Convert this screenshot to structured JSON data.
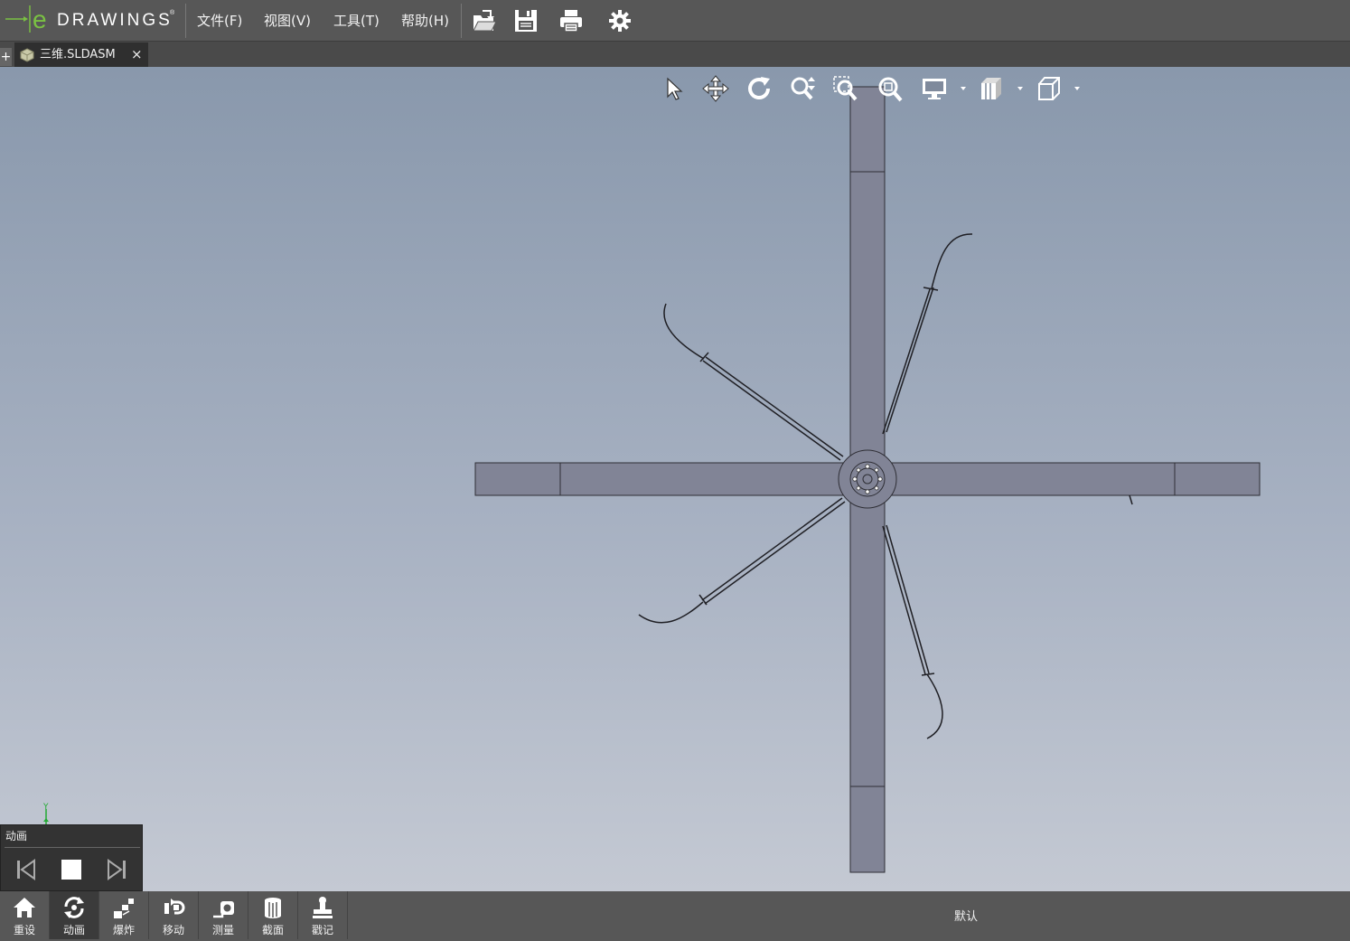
{
  "app": {
    "logo_e": "e",
    "logo_text": "DRAWINGS",
    "logo_mark": "®",
    "brand_color": "#7ac143"
  },
  "menu": {
    "file": "文件(F)",
    "view": "视图(V)",
    "tools": "工具(T)",
    "help": "帮助(H)"
  },
  "toolbar": {
    "icons": [
      "open-icon",
      "save-icon",
      "print-icon",
      "settings-icon"
    ]
  },
  "tabs": [
    {
      "label": "三维.SLDASM",
      "close": "×",
      "icon": "assembly-icon"
    }
  ],
  "tab_add": "+",
  "view_toolbar": {
    "icons": [
      "select-icon",
      "pan-icon",
      "rotate-icon",
      "zoom-icon",
      "zoom-to-area-icon",
      "zoom-to-fit-icon",
      "display-style-icon",
      "section-views-icon",
      "standard-views-icon"
    ]
  },
  "triad": {
    "y_label": "Y",
    "color": "#22aa33"
  },
  "animation": {
    "title": "动画",
    "buttons": [
      "previous-icon",
      "stop-icon",
      "next-icon"
    ]
  },
  "bottom_bar": {
    "items": [
      {
        "label": "重设",
        "icon": "home-icon"
      },
      {
        "label": "动画",
        "icon": "animate-icon",
        "active": true
      },
      {
        "label": "爆炸",
        "icon": "explode-icon"
      },
      {
        "label": "移动",
        "icon": "move-component-icon"
      },
      {
        "label": "测量",
        "icon": "measure-icon"
      },
      {
        "label": "截面",
        "icon": "section-icon"
      },
      {
        "label": "戳记",
        "icon": "stamp-icon"
      }
    ],
    "configuration": "默认"
  },
  "colors": {
    "viewport_top": "#8998ac",
    "viewport_bottom": "#c4c9d3",
    "part_fill": "#818496",
    "chrome": "#575757"
  }
}
